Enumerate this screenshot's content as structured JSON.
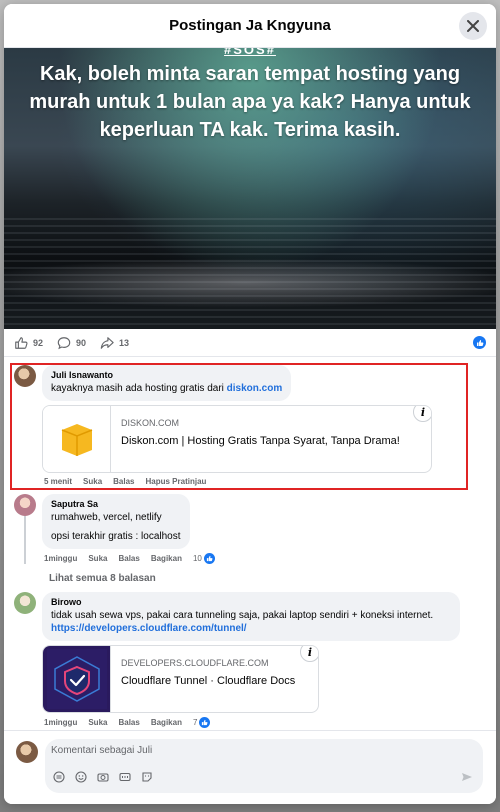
{
  "modal": {
    "title": "Postingan Ja Kngyuna"
  },
  "post": {
    "cutoff_text": "#SOS#",
    "text": "Kak, boleh minta saran tempat hosting yang murah untuk 1 bulan apa ya kak? Hanya untuk keperluan TA kak. Terima kasih."
  },
  "stats": {
    "likes": "92",
    "comments": "90",
    "shares": "13"
  },
  "comments": [
    {
      "name": "Juli Isnawanto",
      "text_before": "kayaknya masih ada hosting gratis dari ",
      "link": "diskon.com",
      "preview": {
        "domain": "DISKON.COM",
        "title": "Diskon.com | Hosting Gratis Tanpa Syarat, Tanpa Drama!"
      },
      "actions": {
        "time": "5 menit",
        "like": "Suka",
        "reply": "Balas",
        "extra": "Hapus Pratinjau"
      }
    },
    {
      "name": "Saputra Sa",
      "line1": "rumahweb, vercel, netlify",
      "line2": "opsi terakhir gratis : localhost",
      "actions": {
        "time": "1minggu",
        "like": "Suka",
        "reply": "Balas",
        "extra": "Bagikan",
        "reactions": "10"
      }
    },
    {
      "name": "Birowo",
      "text": "tidak usah sewa vps, pakai cara tunneling saja, pakai laptop sendiri + koneksi internet.",
      "link": "https://developers.cloudflare.com/tunnel/",
      "preview": {
        "domain": "DEVELOPERS.CLOUDFLARE.COM",
        "title": "Cloudflare Tunnel · Cloudflare Docs"
      },
      "actions": {
        "time": "1minggu",
        "like": "Suka",
        "reply": "Balas",
        "extra": "Bagikan",
        "reactions": "7"
      }
    }
  ],
  "view_replies": "Lihat semua 8 balasan",
  "composer": {
    "placeholder": "Komentari sebagai Juli"
  },
  "colors": {
    "accent": "#1877f2",
    "highlight": "#e02424",
    "bubble": "#f0f2f5"
  }
}
